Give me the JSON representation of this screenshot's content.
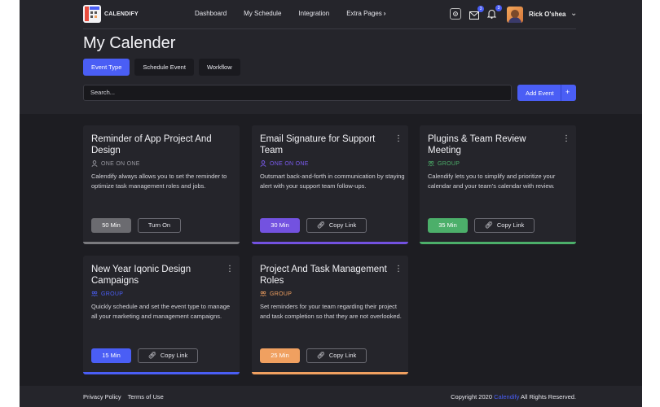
{
  "app": {
    "logo_text": "CALENDIFY"
  },
  "nav": {
    "items": [
      "Dashboard",
      "My Schedule",
      "Integration",
      "Extra Pages"
    ],
    "extra_chevron": "›"
  },
  "header": {
    "mail_badge": "3",
    "bell_badge": "3",
    "user_name": "Rick O'shea"
  },
  "page": {
    "title": "My Calender"
  },
  "tabs": [
    "Event Type",
    "Schedule Event",
    "Workflow"
  ],
  "search": {
    "placeholder": "Search..."
  },
  "add_event": {
    "label": "Add Event",
    "plus": "+"
  },
  "cards": [
    {
      "title": "Reminder of App Project And Design",
      "type": "ONE ON ONE",
      "type_color": "#9a9aa2",
      "desc": "Calendify always allows you to set the reminder to optimize task management roles and jobs.",
      "duration": "50 Min",
      "pill_color": "#6b6b70",
      "action": "Turn On",
      "accent": "#7a7a7e",
      "has_menu": false
    },
    {
      "title": "Email Signature for Support Team",
      "type": "ONE ON ONE",
      "type_color": "#7b5bf0",
      "desc": "Outsmart back-and-forth in communication by staying alert with your support team follow-ups.",
      "duration": "30 Min",
      "pill_color": "#7352e0",
      "action": "Copy Link",
      "accent": "#7352e0",
      "has_menu": true
    },
    {
      "title": "Plugins & Team Review Meeting",
      "type": "GROUP",
      "type_color": "#4caf6a",
      "desc": "Calendify lets you to simplify and prioritize your calendar and your team's calendar with review.",
      "duration": "35 Min",
      "pill_color": "#4caf6a",
      "action": "Copy Link",
      "accent": "#4caf6a",
      "has_menu": true
    },
    {
      "title": "New Year Iqonic Design Campaigns",
      "type": "GROUP",
      "type_color": "#4a5ef5",
      "desc": "Quickly schedule and set the event type to manage all your marketing and management campaigns.",
      "duration": "15 Min",
      "pill_color": "#4a5ef5",
      "action": "Copy Link",
      "accent": "#4a5ef5",
      "has_menu": true
    },
    {
      "title": "Project And Task Management Roles",
      "type": "GROUP",
      "type_color": "#f0a060",
      "desc": "Set reminders for your team regarding their project and task completion so that they are not overlooked.",
      "duration": "25 Min",
      "pill_color": "#f0a060",
      "action": "Copy Link",
      "accent": "#f0a060",
      "has_menu": true
    }
  ],
  "footer": {
    "links": [
      "Privacy Policy",
      "Terms of Use"
    ],
    "copyright_prefix": "Copyright 2020",
    "brand": "Calendify",
    "copyright_suffix": "All Rights Reserved."
  }
}
